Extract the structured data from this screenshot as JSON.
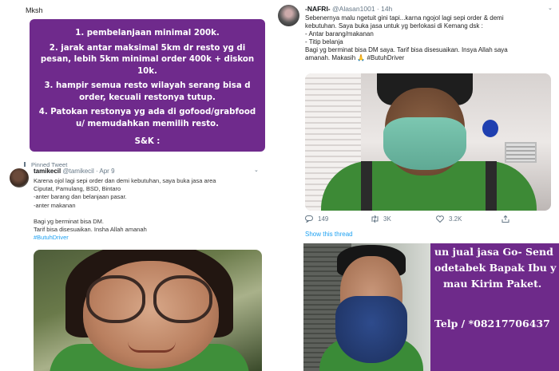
{
  "note_panel": {
    "heading": "Mksh",
    "items": [
      "1. pembelanjaan minimal 200k.",
      "2. jarak antar maksimal 5km dr resto yg di pesan, lebih 5km minimal order 400k + diskon 10k.",
      "3. hampir semua resto wilayah serang bisa d order, kecuali restonya tutup.",
      "4. Patokan restonya yg ada di gofood/grabfood u/ memudahkan memilih resto."
    ],
    "footer": "S&K :"
  },
  "tweet_left": {
    "pinned_label": "Pinned Tweet",
    "display_name": "tamikecil",
    "handle_date": "@tamikecil · Apr 9",
    "lines": [
      "Karena ojol lagi sepi order dan demi kebutuhan, saya buka jasa area",
      "Ciputat, Pamulang, BSD, Bintaro",
      "-anter barang dan belanjaan pasar.",
      "-anter makanan",
      "",
      "Bagi yg berminat bisa DM.",
      "Tarif bisa disesuaikan. Insha Allah amanah"
    ],
    "hashtag": "#ButuhDriver"
  },
  "tweet_right": {
    "display_name": "-NAFRI-",
    "handle_time": "@Alasan1001 · 14h",
    "lines": [
      "Sebenernya malu ngetuit gini tapi...karna ngojol lagi sepi order & demi",
      "kebutuhan. Saya buka jasa untuk yg berlokasi di Kemang dsk :",
      "- Antar barang/makanan",
      "- Titip belanja",
      "Bagi yg berminat bisa DM saya. Tarif bisa disesuaikan. Insya Allah saya",
      "amanah. Makasih 🙏 #ButuhDriver"
    ],
    "replies": "149",
    "retweets": "3K",
    "likes": "3.2K",
    "show_thread": "Show this thread",
    "accent": "#1da1f2"
  },
  "ad_panel": {
    "lines": [
      "un jual jasa  Go- Send",
      "odetabek  Bapak Ibu y",
      "mau Kirim Paket.",
      "",
      "Telp /  *08217706437"
    ],
    "purple": "#6e2a8a"
  }
}
